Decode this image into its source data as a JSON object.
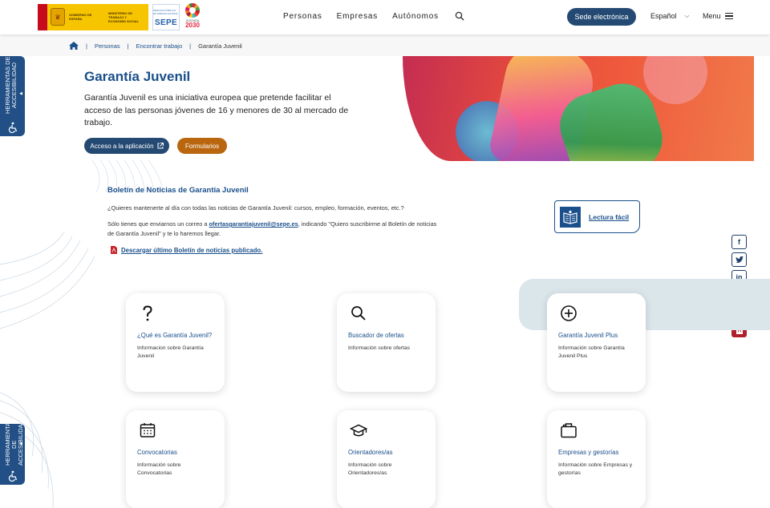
{
  "header": {
    "gov_text": "GOBIERNO DE ESPAÑA",
    "ministry_text": "MINISTERIO DE TRABAJO Y ECONOMÍA SOCIAL",
    "sepe_small": "SERVICIO PÚBLICO DE EMPLEO ESTATAL",
    "sepe_label": "SEPE",
    "agenda_label": "AGENDA",
    "agenda_year": "2030",
    "nav": [
      "Personas",
      "Empresas",
      "Autónomos"
    ],
    "sede_label": "Sede electrónica",
    "language": "Español",
    "menu_label": "Menu"
  },
  "breadcrumb": {
    "items": [
      "Personas",
      "Encontrar trabajo"
    ],
    "current": "Garantía Juvenil"
  },
  "hero": {
    "title": "Garantía Juvenil",
    "description": "Garantía Juvenil es una iniciativa europea que pretende facilitar el acceso de las personas jóvenes de 16 y menores de 30 al mercado de trabajo.",
    "app_button": "Acceso a la aplicación",
    "forms_button": "Formularios"
  },
  "accessibility": {
    "label": "HERRAMIENTAS DE ACCESIBILIDAD"
  },
  "boletin": {
    "title": "Boletín de Noticias de Garantía Juvenil",
    "p1": "¿Quieres mantenerte al día con todas las noticias de Garantía Juvenil: cursos, empleo, formación, eventos, etc.?",
    "p2_before": "Sólo tienes que enviarnos un correo a ",
    "p2_email": "ofertasgarantiajuvenil@sepe.es",
    "p2_after": ", indicando \"Quiero suscribirme al Boletín de noticias de Garantía Juvenil\" y te lo haremos llegar.",
    "download": "Descargar último Boletín de noticias publicado."
  },
  "lectura_facil": "Lectura fácil",
  "social": [
    "f",
    "t",
    "in",
    "▶",
    "◎",
    "pdf"
  ],
  "cards": [
    {
      "title": "¿Qué es Garantía Juvenil?",
      "desc": "Informacion sobre Garantía Juvenil",
      "icon": "question-icon"
    },
    {
      "title": "Buscador de ofertas",
      "desc": "Información sobre ofertas",
      "icon": "search-icon"
    },
    {
      "title": "Garantía Juvenil Plus",
      "desc": "Información sobre Garantía Juvenil Plus",
      "icon": "plus-circle-icon"
    },
    {
      "title": "Convocatorias",
      "desc": "Información sobre Convocatorias",
      "icon": "calendar-icon"
    },
    {
      "title": "Orientadores/as",
      "desc": "Información sobre Orientadores/as",
      "icon": "graduation-cap-icon"
    },
    {
      "title": "Empresas y gestorías",
      "desc": "Información sobre Empresas y gestorías",
      "icon": "briefcase-icon"
    }
  ],
  "colors": {
    "primary": "#1a4f8b",
    "button_dark": "#244a73",
    "button_orange": "#b9660f",
    "pdf_red": "#b0202c"
  }
}
